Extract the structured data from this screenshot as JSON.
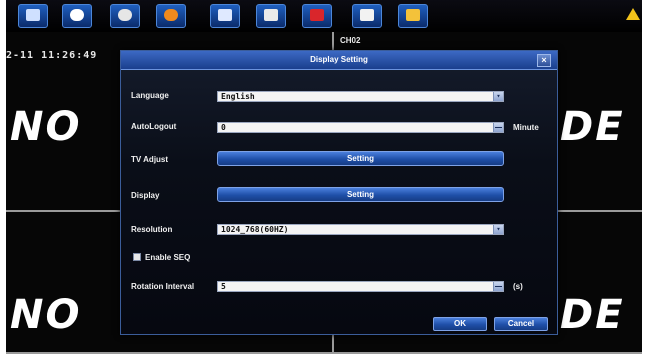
{
  "camera": {
    "timestamp": "2-11 11:26:49",
    "channel_label": "CH02",
    "no_video_left_top": "NO",
    "no_video_right_top": "DE",
    "no_video_left_bottom": "NO",
    "no_video_right_bottom": "DE"
  },
  "taskbar": {
    "icons": [
      "menu-icon",
      "record-icon",
      "playback-icon",
      "ptz-icon",
      "color-icon",
      "video-icon",
      "alarm-icon",
      "camera-icon",
      "folder-icon"
    ],
    "warning_icon": "warning-icon"
  },
  "dialog": {
    "title": "Display Setting",
    "close_glyph": "×",
    "language_label": "Language",
    "language_value": "English",
    "autologout_label": "AutoLogout",
    "autologout_value": "0",
    "autologout_unit": "Minute",
    "tv_adjust_label": "TV Adjust",
    "tv_adjust_button": "Setting",
    "display_label": "Display",
    "display_button": "Setting",
    "resolution_label": "Resolution",
    "resolution_value": "1024_768(60HZ)",
    "enable_seq_label": "Enable SEQ",
    "rotation_label": "Rotation Interval",
    "rotation_value": "5",
    "rotation_unit": "(s)",
    "ok_label": "OK",
    "cancel_label": "Cancel"
  },
  "colors": {
    "accent_blue": "#1f4fa8",
    "title_blue": "#3c69c4",
    "background": "#060606"
  }
}
